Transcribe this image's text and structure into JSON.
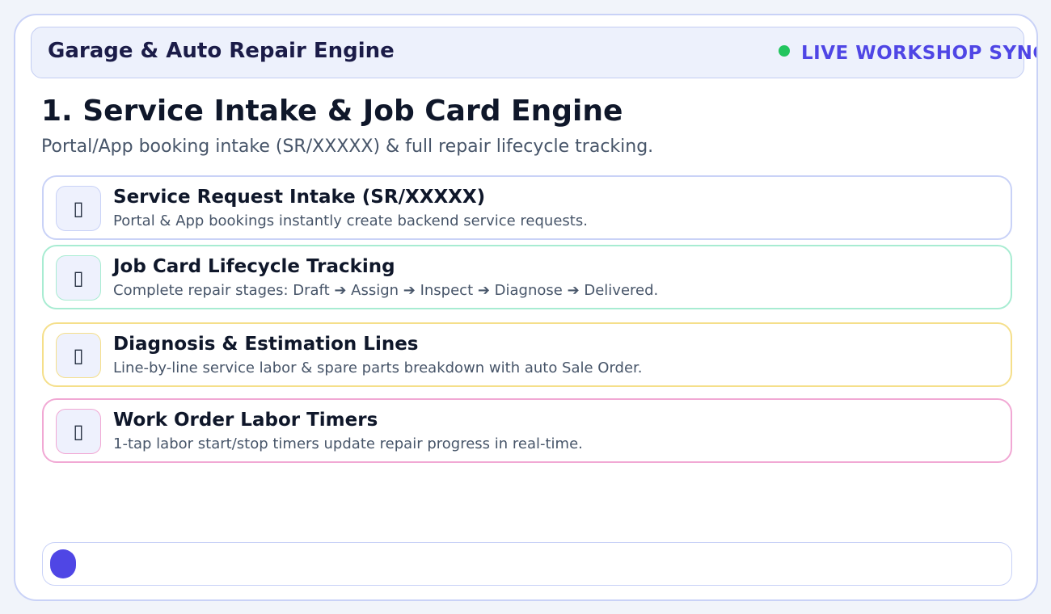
{
  "header": {
    "app_title": "Garage & Auto Repair Engine",
    "sync_label": "LIVE WORKSHOP SYNC",
    "sync_status_color": "#22c55e"
  },
  "main": {
    "title": "1. Service Intake & Job Card Engine",
    "subtitle": "Portal/App booking intake (SR/XXXXX) & full repair lifecycle tracking."
  },
  "features": [
    {
      "icon": "clipboard-icon",
      "icon_glyph": "▯",
      "title": "Service Request Intake (SR/XXXXX)",
      "description": "Portal & App bookings instantly create backend service requests.",
      "accent": "#c9d2f7"
    },
    {
      "icon": "lifecycle-icon",
      "icon_glyph": "▯",
      "title": "Job Card Lifecycle Tracking",
      "description": "Complete repair stages: Draft ➔ Assign ➔ Inspect ➔ Diagnose ➔ Delivered.",
      "accent": "#a8ecd2"
    },
    {
      "icon": "estimate-icon",
      "icon_glyph": "▯",
      "title": "Diagnosis & Estimation Lines",
      "description": "Line-by-line service labor & spare parts breakdown with auto Sale Order.",
      "accent": "#f5df8a"
    },
    {
      "icon": "timer-icon",
      "icon_glyph": "▯",
      "title": "Work Order Labor Timers",
      "description": "1-tap labor start/stop timers update repair progress in real-time.",
      "accent": "#f1a8d4"
    }
  ],
  "footer": {
    "indicator_color": "#4f46e5"
  }
}
